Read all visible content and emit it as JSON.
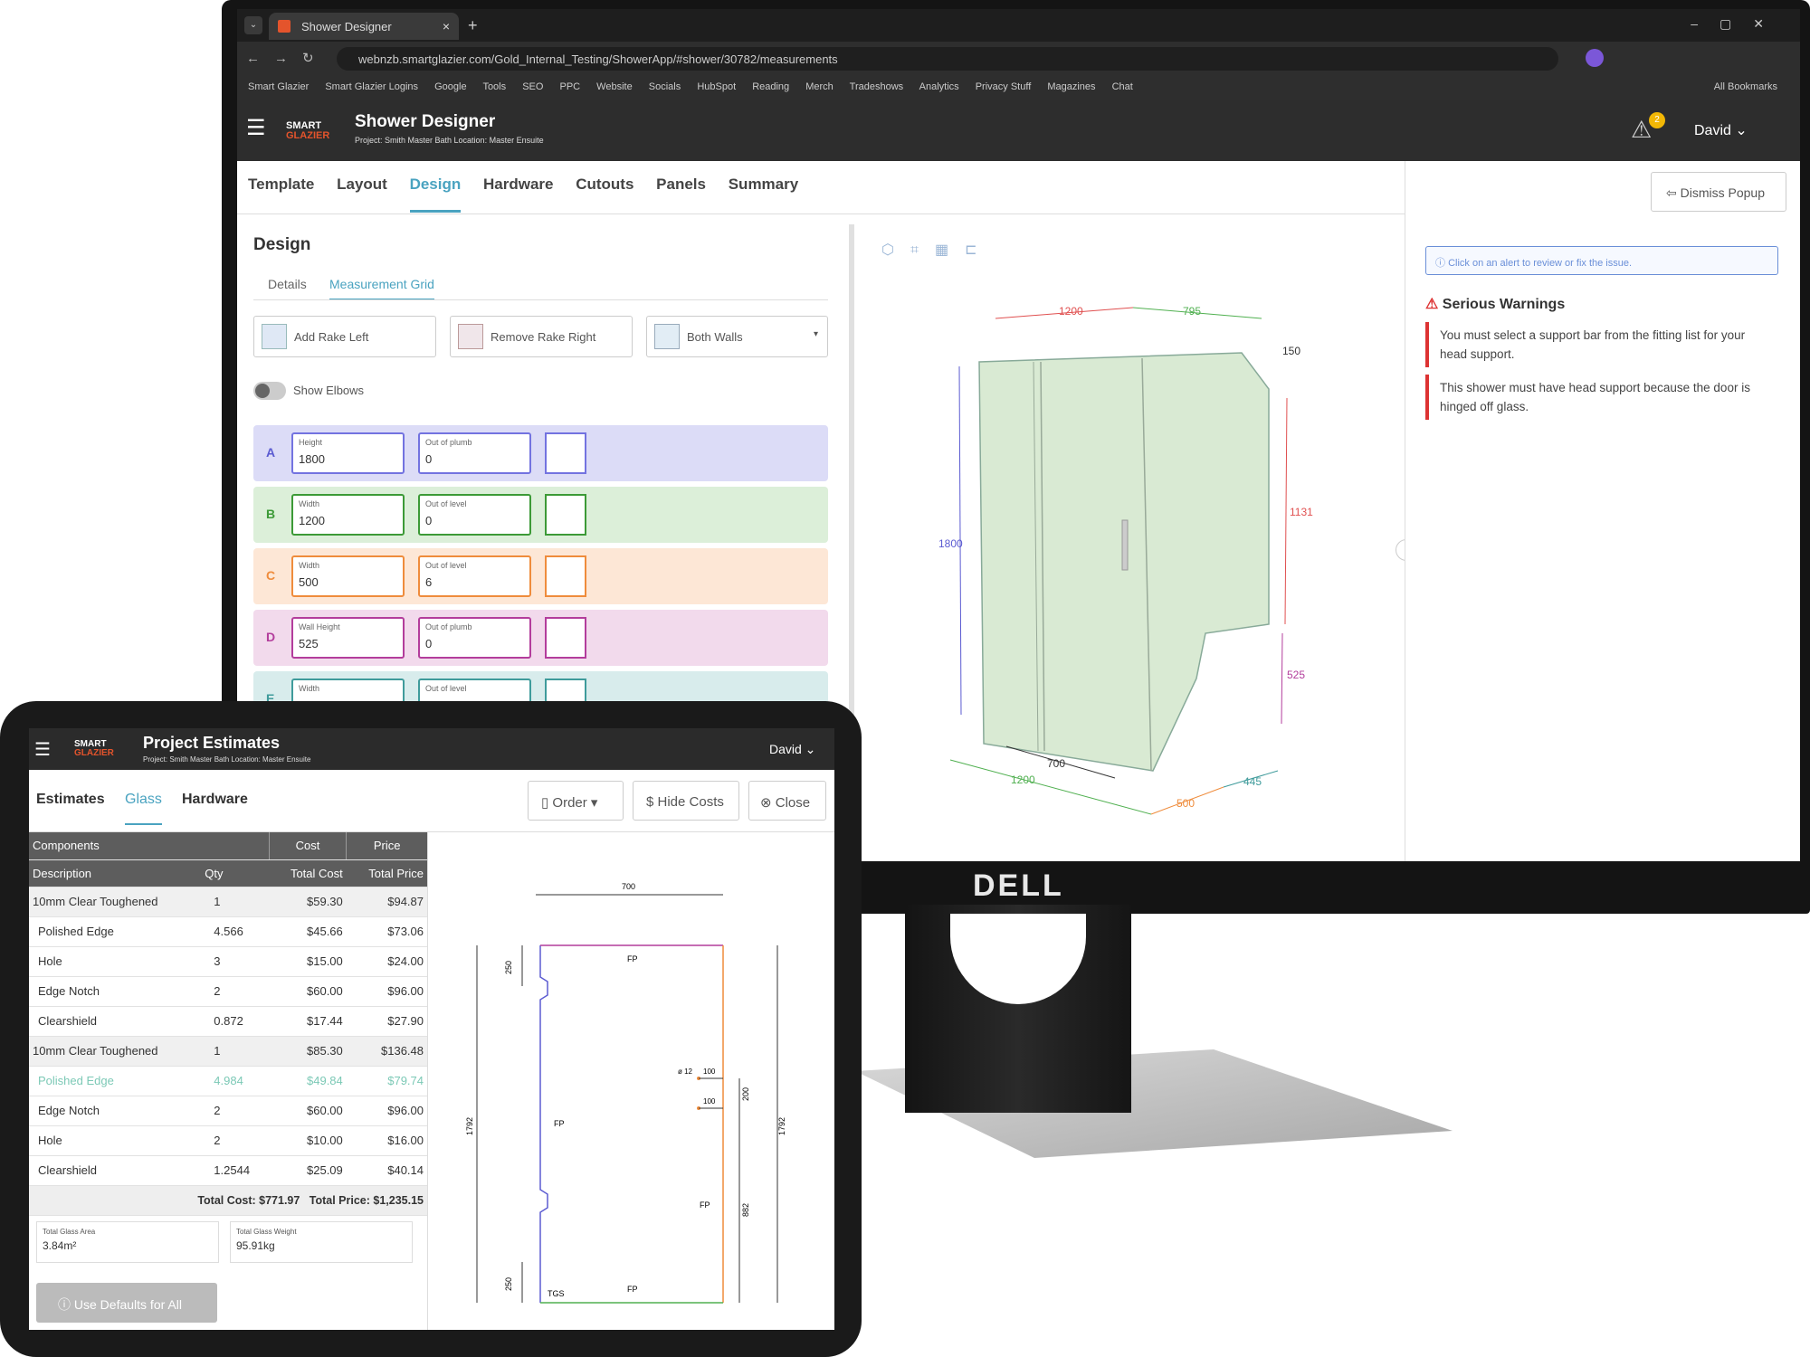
{
  "browser": {
    "tab_title": "Shower Designer",
    "url": "webnzb.smartglazier.com/Gold_Internal_Testing/ShowerApp/#shower/30782/measurements",
    "bookmarks": [
      "Smart Glazier",
      "Smart Glazier Logins",
      "Google",
      "Tools",
      "SEO",
      "PPC",
      "Website",
      "Socials",
      "HubSpot",
      "Reading",
      "Merch",
      "Tradeshows",
      "Analytics",
      "Privacy Stuff",
      "Magazines",
      "Chat"
    ],
    "all_bookmarks": "All Bookmarks"
  },
  "designer": {
    "logo_top": "SMART",
    "logo_bottom": "GLAZIER",
    "title": "Shower Designer",
    "subtitle": "Project: Smith Master Bath  Location: Master Ensuite",
    "user": "David",
    "alert_count": "2",
    "nav_tabs": [
      "Template",
      "Layout",
      "Design",
      "Hardware",
      "Cutouts",
      "Panels",
      "Summary"
    ],
    "active_tab": "Design",
    "section_title": "Design",
    "sub_tabs": [
      "Details",
      "Measurement Grid"
    ],
    "buttons": {
      "rake_left": "Add Rake Left",
      "rake_right": "Remove Rake Right",
      "walls": "Both Walls"
    },
    "show_elbows": "Show Elbows",
    "rows": [
      {
        "letter": "A",
        "f1_label": "Height",
        "f1_value": "1800",
        "f2_label": "Out of plumb",
        "f2_value": "0"
      },
      {
        "letter": "B",
        "f1_label": "Width",
        "f1_value": "1200",
        "f2_label": "Out of level",
        "f2_value": "0"
      },
      {
        "letter": "C",
        "f1_label": "Width",
        "f1_value": "500",
        "f2_label": "Out of level",
        "f2_value": "6"
      },
      {
        "letter": "D",
        "f1_label": "Wall Height",
        "f1_value": "525",
        "f2_label": "Out of plumb",
        "f2_value": "0"
      },
      {
        "letter": "E",
        "f1_label": "Width",
        "f1_value": "",
        "f2_label": "Out of level",
        "f2_value": ""
      }
    ],
    "dims": {
      "top1": "1200",
      "top2": "795",
      "rake": "150",
      "left": "1800",
      "right": "1131",
      "lowright": "525",
      "b1": "700",
      "b2": "1200",
      "b3": "500",
      "b4": "445"
    }
  },
  "warnings": {
    "dismiss": "Dismiss Popup",
    "info": "Click on an alert to review or fix the issue.",
    "heading": "Serious Warnings",
    "items": [
      "You must select a support bar from the fitting list for your head support.",
      "This shower must have head support because the door is hinged off glass."
    ]
  },
  "monitor_brand": "DELL",
  "estimates": {
    "title": "Project Estimates",
    "subtitle": "Project: Smith Master Bath  Location: Master Ensuite",
    "user": "David",
    "tabs": [
      "Estimates",
      "Glass",
      "Hardware"
    ],
    "active_tab": "Glass",
    "buttons": {
      "order": "Order",
      "hide": "Hide Costs",
      "close": "Close"
    },
    "group_headers": {
      "components": "Components",
      "cost": "Cost",
      "price": "Price"
    },
    "columns": [
      "Description",
      "Qty",
      "Total Cost",
      "Total Price"
    ],
    "rows": [
      {
        "d": "10mm Clear Toughened",
        "q": "1",
        "c": "$59.30",
        "p": "$94.87",
        "type": "main"
      },
      {
        "d": "Polished Edge",
        "q": "4.566",
        "c": "$45.66",
        "p": "$73.06",
        "type": "sub"
      },
      {
        "d": "Hole",
        "q": "3",
        "c": "$15.00",
        "p": "$24.00",
        "type": "sub"
      },
      {
        "d": "Edge Notch",
        "q": "2",
        "c": "$60.00",
        "p": "$96.00",
        "type": "sub"
      },
      {
        "d": "Clearshield",
        "q": "0.872",
        "c": "$17.44",
        "p": "$27.90",
        "type": "sub"
      },
      {
        "d": "10mm Clear Toughened",
        "q": "1",
        "c": "$85.30",
        "p": "$136.48",
        "type": "main"
      },
      {
        "d": "Polished Edge",
        "q": "4.984",
        "c": "$49.84",
        "p": "$79.74",
        "type": "hl"
      },
      {
        "d": "Edge Notch",
        "q": "2",
        "c": "$60.00",
        "p": "$96.00",
        "type": "sub"
      },
      {
        "d": "Hole",
        "q": "2",
        "c": "$10.00",
        "p": "$16.00",
        "type": "sub"
      },
      {
        "d": "Clearshield",
        "q": "1.2544",
        "c": "$25.09",
        "p": "$40.14",
        "type": "sub"
      }
    ],
    "total_cost": "Total Cost: $771.97",
    "total_price": "Total Price: $1,235.15",
    "glass_area_label": "Total Glass Area",
    "glass_area": "3.84m²",
    "glass_weight_label": "Total Glass Weight",
    "glass_weight": "95.91kg",
    "defaults_btn": "Use Defaults for All",
    "drawing": {
      "width": "700",
      "top_fp": "FP",
      "left_fp": "FP",
      "right_fp": "FP",
      "bottom_fp": "FP",
      "tgs": "TGS",
      "notch": "250",
      "notch2": "250",
      "height": "1792",
      "height2": "1792",
      "hole": "ø 12",
      "off1": "100",
      "off2": "100",
      "v1": "200",
      "v2": "882"
    }
  }
}
